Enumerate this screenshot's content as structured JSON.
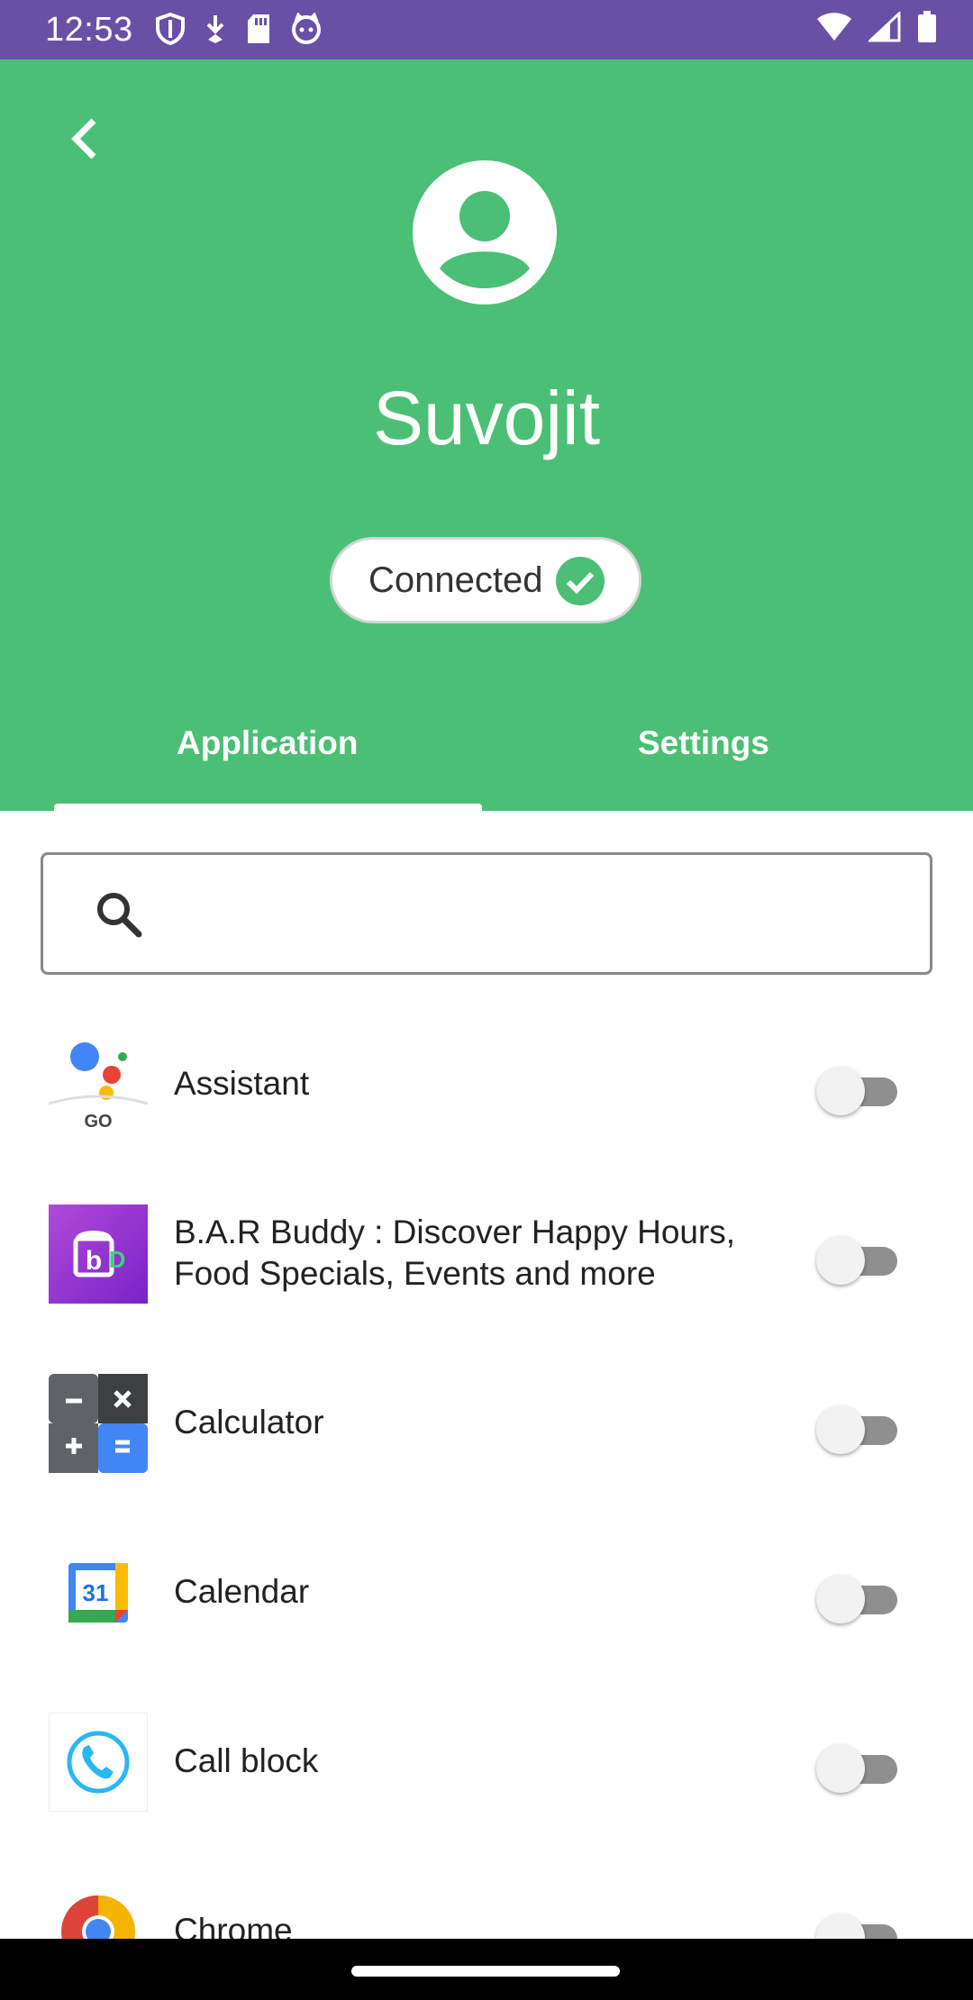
{
  "status_bar": {
    "time": "12:53",
    "background": "#6a4fa6"
  },
  "header": {
    "background": "#4bbf75",
    "profile_name": "Suvojit",
    "connection_status": "Connected"
  },
  "tabs": [
    {
      "label": "Application",
      "selected": true
    },
    {
      "label": "Settings",
      "selected": false
    }
  ],
  "search": {
    "placeholder": "",
    "value": ""
  },
  "apps": [
    {
      "name": "Assistant",
      "icon": "assistant-go-icon",
      "enabled": false
    },
    {
      "name": "B.A.R Buddy : Discover Happy Hours, Food Specials, Events and more",
      "icon": "bar-buddy-icon",
      "enabled": false
    },
    {
      "name": "Calculator",
      "icon": "calculator-icon",
      "enabled": false
    },
    {
      "name": "Calendar",
      "icon": "calendar-icon",
      "enabled": false,
      "icon_text": "31"
    },
    {
      "name": "Call block",
      "icon": "call-block-icon",
      "enabled": false
    },
    {
      "name": "Chrome",
      "icon": "chrome-icon",
      "enabled": false
    }
  ]
}
